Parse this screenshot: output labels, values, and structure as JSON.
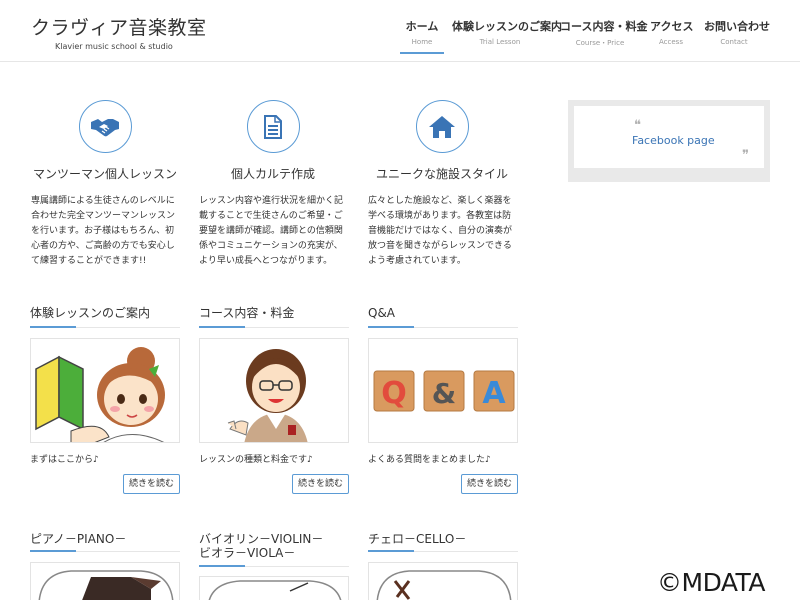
{
  "site": {
    "title": "クラヴィア音楽教室",
    "subtitle": "Klavier music school & studio"
  },
  "nav": [
    {
      "label": "ホーム",
      "sub": "Home"
    },
    {
      "label": "体験レッスンのご案内",
      "sub": "Trial Lesson"
    },
    {
      "label": "コース内容・料金",
      "sub": "Course・Price"
    },
    {
      "label": "アクセス",
      "sub": "Access"
    },
    {
      "label": "お問い合わせ",
      "sub": "Contact"
    }
  ],
  "features": [
    {
      "icon": "handshake-icon",
      "title": "マンツーマン個人レッスン",
      "text": "専属講師による生徒さんのレベルに合わせた完全マンツーマンレッスンを行います。お子様はもちろん、初心者の方や、ご高齢の方でも安心して練習することができます!!"
    },
    {
      "icon": "document-icon",
      "title": "個人カルテ作成",
      "text": "レッスン内容や進行状況を細かく記載することで生徒さんのご希望・ご要望を講師が確認。講師との信頼関係やコミュニケーションの充実が、より早い成長へとつながります。"
    },
    {
      "icon": "home-icon",
      "title": "ユニークな施設スタイル",
      "text": "広々とした施設など、楽しく楽器を学べる環境があります。各教室は防音機能だけではなく、自分の演奏が放つ音を聞きながらレッスンできるよう考慮されています。"
    }
  ],
  "sections": [
    {
      "title": "体験レッスンのご案内",
      "desc": "まずはここから♪",
      "button": "続きを読む"
    },
    {
      "title": "コース内容・料金",
      "desc": "レッスンの種類と料金です♪",
      "button": "続きを読む"
    },
    {
      "title": "Q&A",
      "desc": "よくある質問をまとめました♪",
      "button": "続きを読む"
    }
  ],
  "qa_tiles": [
    "Q",
    "&",
    "A"
  ],
  "instruments": [
    {
      "title_line1": "ピアノ－PIANO－",
      "title_line2": ""
    },
    {
      "title_line1": "バイオリン－VIOLIN－",
      "title_line2": "ビオラ－VIOLA－"
    },
    {
      "title_line1": "チェロ－CELLO－",
      "title_line2": ""
    }
  ],
  "sidebar": {
    "facebook_label": "Facebook page"
  },
  "watermark": "©MDATA",
  "colors": {
    "accent": "#5b9bd5",
    "link": "#3a74b5",
    "rule": "#e6e6e6"
  }
}
